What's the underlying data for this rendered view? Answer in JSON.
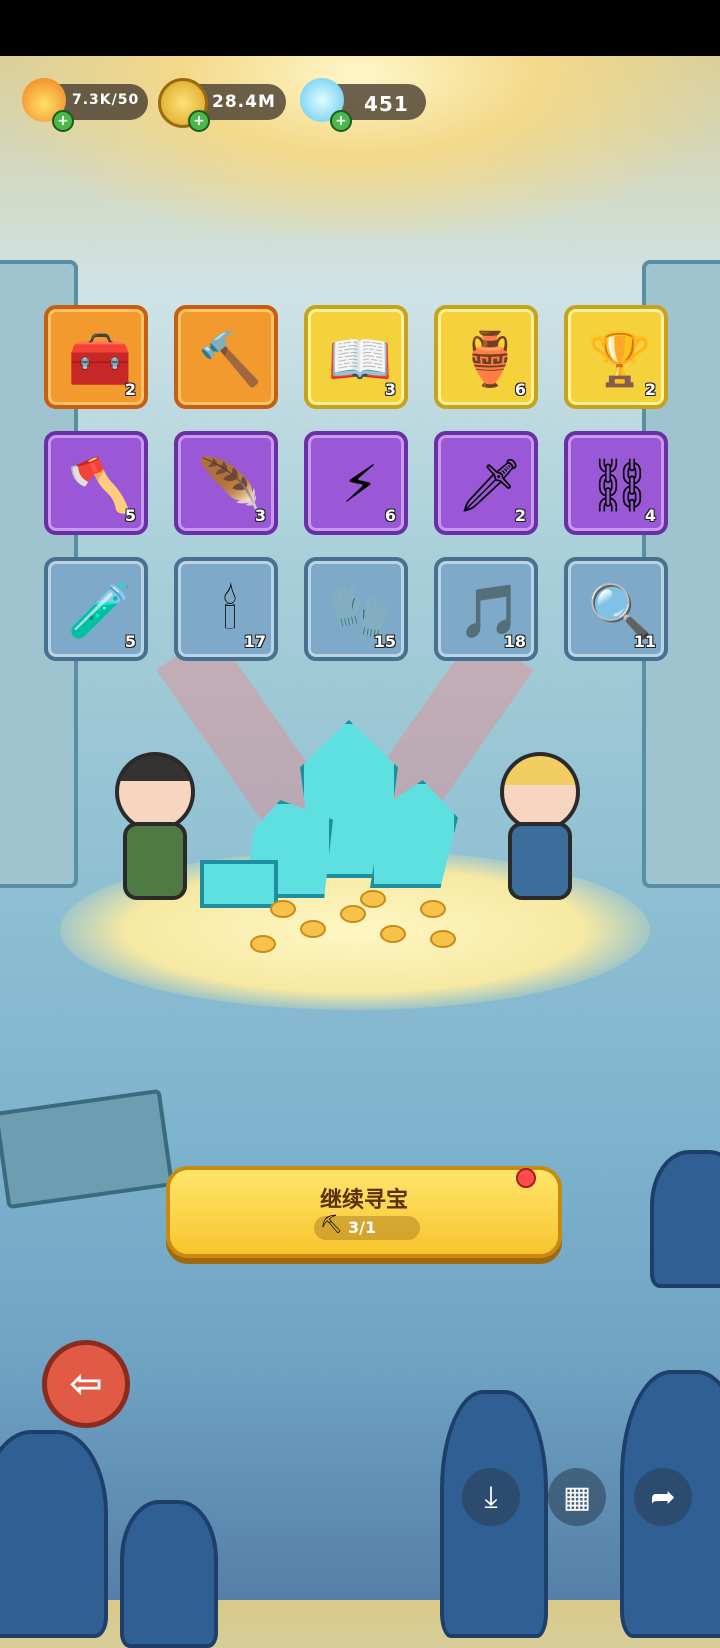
{
  "resources": {
    "energy": {
      "value": "7.3K/50",
      "icon": "flame-icon"
    },
    "coins": {
      "value": "28.4M",
      "icon": "coin-icon"
    },
    "crystals": {
      "value": "451",
      "icon": "crystal-icon"
    }
  },
  "items": [
    {
      "icon": "treasure-chest-icon",
      "glyph": "🧰",
      "count": "2",
      "rarity": "orange"
    },
    {
      "icon": "hammer-icon",
      "glyph": "🔨",
      "count": "",
      "rarity": "orange"
    },
    {
      "icon": "spellbook-icon",
      "glyph": "📖",
      "count": "3",
      "rarity": "gold"
    },
    {
      "icon": "vase-icon",
      "glyph": "🏺",
      "count": "6",
      "rarity": "gold"
    },
    {
      "icon": "chalice-icon",
      "glyph": "🏆",
      "count": "2",
      "rarity": "gold"
    },
    {
      "icon": "axe-icon",
      "glyph": "🪓",
      "count": "5",
      "rarity": "purple"
    },
    {
      "icon": "phoenix-feather-icon",
      "glyph": "🪶",
      "count": "3",
      "rarity": "purple"
    },
    {
      "icon": "lightning-scroll-icon",
      "glyph": "⚡",
      "count": "6",
      "rarity": "purple"
    },
    {
      "icon": "ice-sword-icon",
      "glyph": "🗡",
      "count": "2",
      "rarity": "purple"
    },
    {
      "icon": "vine-chain-icon",
      "glyph": "⛓",
      "count": "4",
      "rarity": "purple"
    },
    {
      "icon": "potion-icon",
      "glyph": "🧪",
      "count": "5",
      "rarity": "blue"
    },
    {
      "icon": "candle-icon",
      "glyph": "🕯",
      "count": "17",
      "rarity": "blue"
    },
    {
      "icon": "glove-icon",
      "glyph": "🧤",
      "count": "15",
      "rarity": "blue"
    },
    {
      "icon": "lyre-icon",
      "glyph": "🎵",
      "count": "18",
      "rarity": "blue"
    },
    {
      "icon": "mirror-icon",
      "glyph": "🔍",
      "count": "11",
      "rarity": "blue"
    }
  ],
  "cta": {
    "label": "继续寻宝",
    "count": "3/1",
    "icon": "pickaxe-icon"
  },
  "back": {
    "icon": "back-arrow-icon",
    "glyph": "⇦"
  },
  "toolbar": [
    {
      "icon": "download-icon",
      "glyph": "⤓"
    },
    {
      "icon": "grid-icon",
      "glyph": "▦"
    },
    {
      "icon": "share-icon",
      "glyph": "➦"
    }
  ]
}
